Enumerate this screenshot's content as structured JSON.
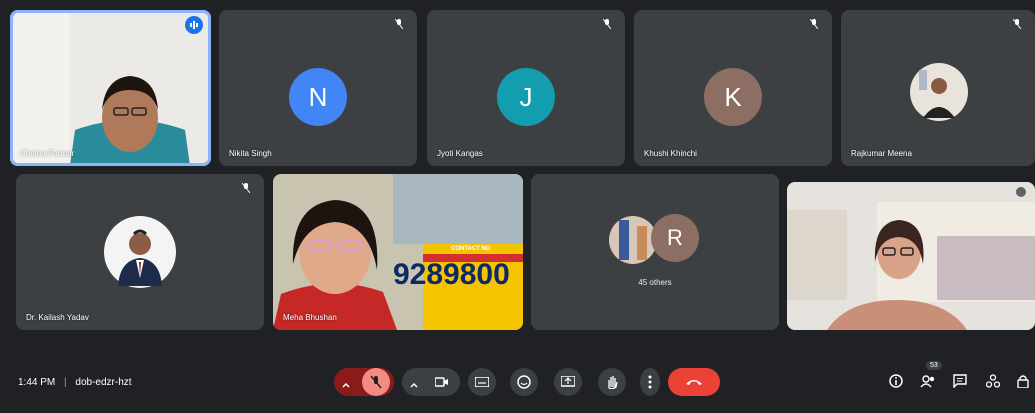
{
  "participants": [
    {
      "name": "Chetna Parmar",
      "type": "video"
    },
    {
      "name": "Nikita Singh",
      "initial": "N",
      "color": "#4285f4"
    },
    {
      "name": "Jyoti Kangas",
      "initial": "J",
      "color": "#129eaf"
    },
    {
      "name": "Khushi Khinchi",
      "initial": "K",
      "color": "#8d6e63"
    },
    {
      "name": "Rajkumar Meena",
      "type": "photo"
    },
    {
      "name": "Dr. Kailash Yadav",
      "type": "photo"
    },
    {
      "name": "Meha Bhushan",
      "type": "video"
    },
    {
      "name": "45 others",
      "initial": "R",
      "color": "#8d6e63"
    },
    {
      "name": "",
      "type": "video"
    }
  ],
  "banner_text": "9289800",
  "banner_small": "CONTACT NO",
  "meeting": {
    "time": "1:44 PM",
    "separator": "|",
    "code": "dob-edzr-hzt"
  },
  "people_count": "53",
  "colors": {
    "background": "#202124",
    "tile": "#3c4043",
    "end_call": "#ea4335",
    "accent": "#8ab4f8"
  },
  "icons": [
    "mic-off-icon",
    "camera-icon",
    "captions-icon",
    "emoji-icon",
    "present-icon",
    "raise-hand-icon",
    "more-icon",
    "end-call-icon",
    "info-icon",
    "people-icon",
    "chat-icon",
    "activities-icon",
    "host-controls-icon"
  ]
}
